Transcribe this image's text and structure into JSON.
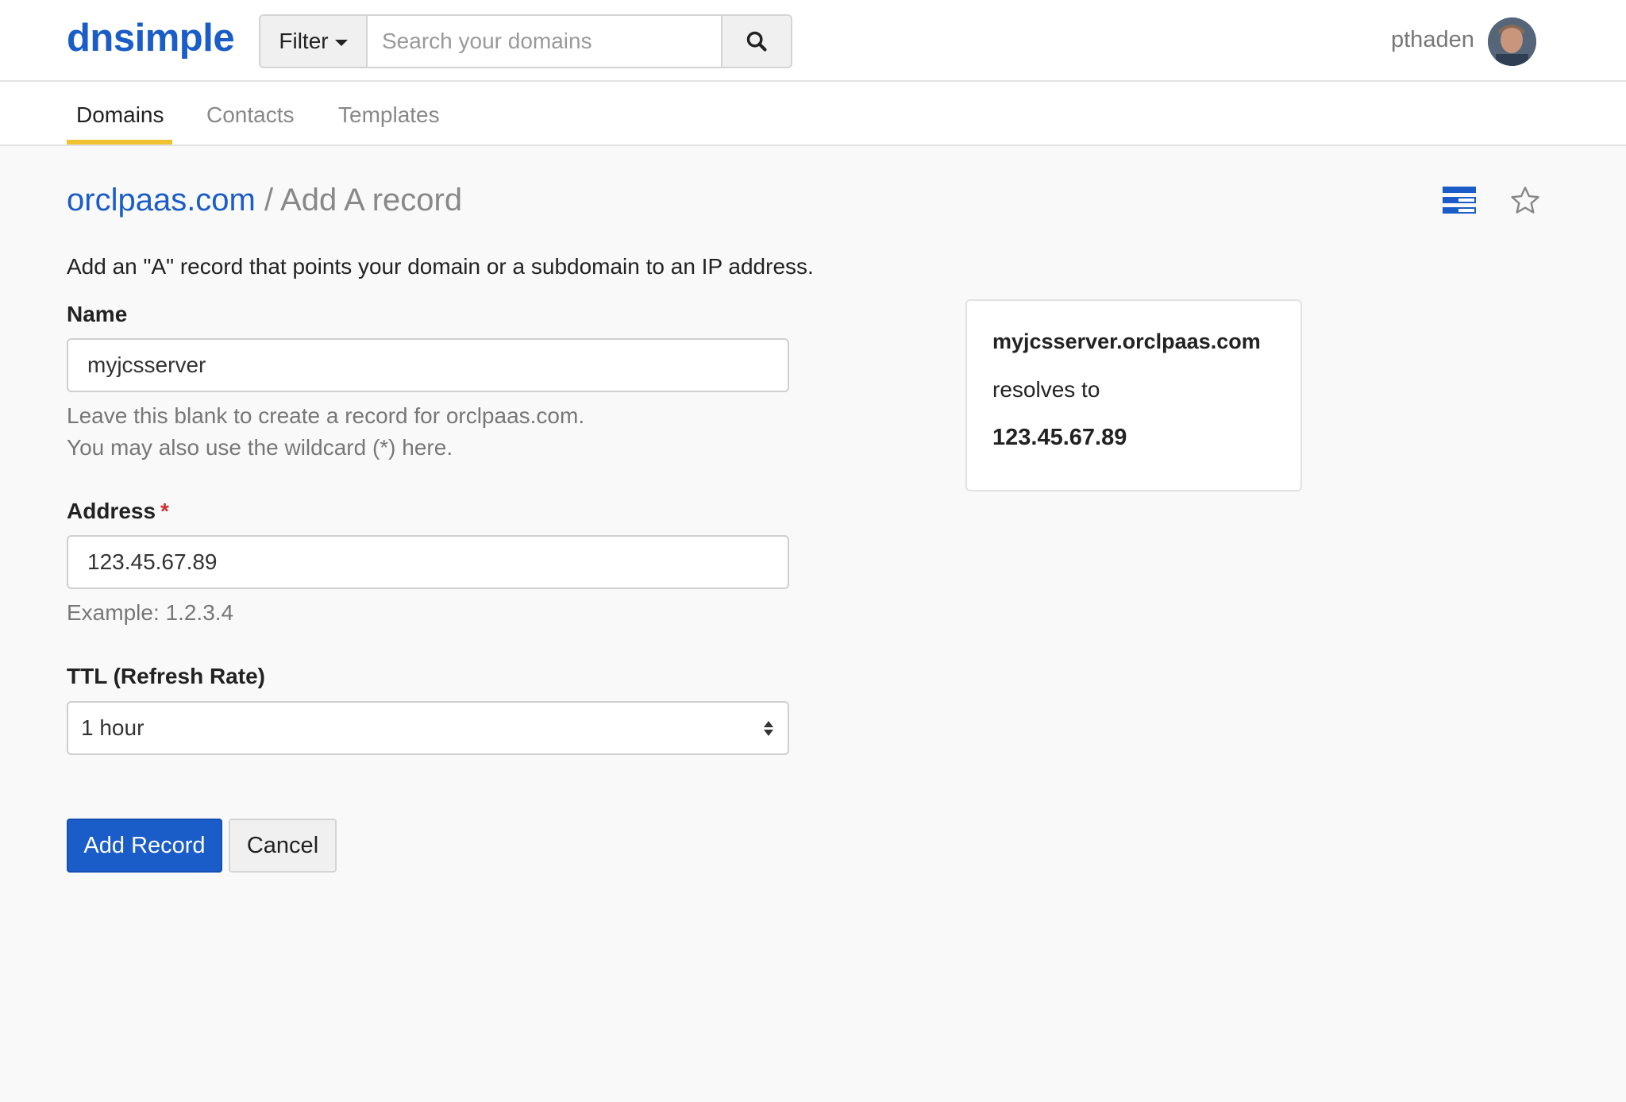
{
  "header": {
    "logo": "dnsimple",
    "filter_label": "Filter",
    "search_placeholder": "Search your domains",
    "username": "pthaden"
  },
  "nav": {
    "tabs": [
      {
        "label": "Domains",
        "active": true
      },
      {
        "label": "Contacts",
        "active": false
      },
      {
        "label": "Templates",
        "active": false
      }
    ]
  },
  "page": {
    "domain": "orclpaas.com",
    "separator": "/",
    "title": "Add A record",
    "intro": "Add an \"A\" record that points your domain or a subdomain to an IP address."
  },
  "form": {
    "name": {
      "label": "Name",
      "value": "myjcsserver",
      "help_line1": "Leave this blank to create a record for orclpaas.com.",
      "help_line2": "You may also use the wildcard (*) here."
    },
    "address": {
      "label": "Address",
      "required_mark": "*",
      "value": "123.45.67.89",
      "help": "Example: 1.2.3.4"
    },
    "ttl": {
      "label": "TTL (Refresh Rate)",
      "selected": "1 hour"
    },
    "submit_label": "Add Record",
    "cancel_label": "Cancel"
  },
  "preview": {
    "hostname": "myjcsserver.orclpaas.com",
    "middle": "resolves to",
    "ip": "123.45.67.89"
  },
  "colors": {
    "brand": "#1a5cc8",
    "active_tab_underline": "#f1c232",
    "required": "#d0302c"
  },
  "icons": {
    "search": "search-icon",
    "list": "list-view-icon",
    "star": "star-outline-icon"
  }
}
